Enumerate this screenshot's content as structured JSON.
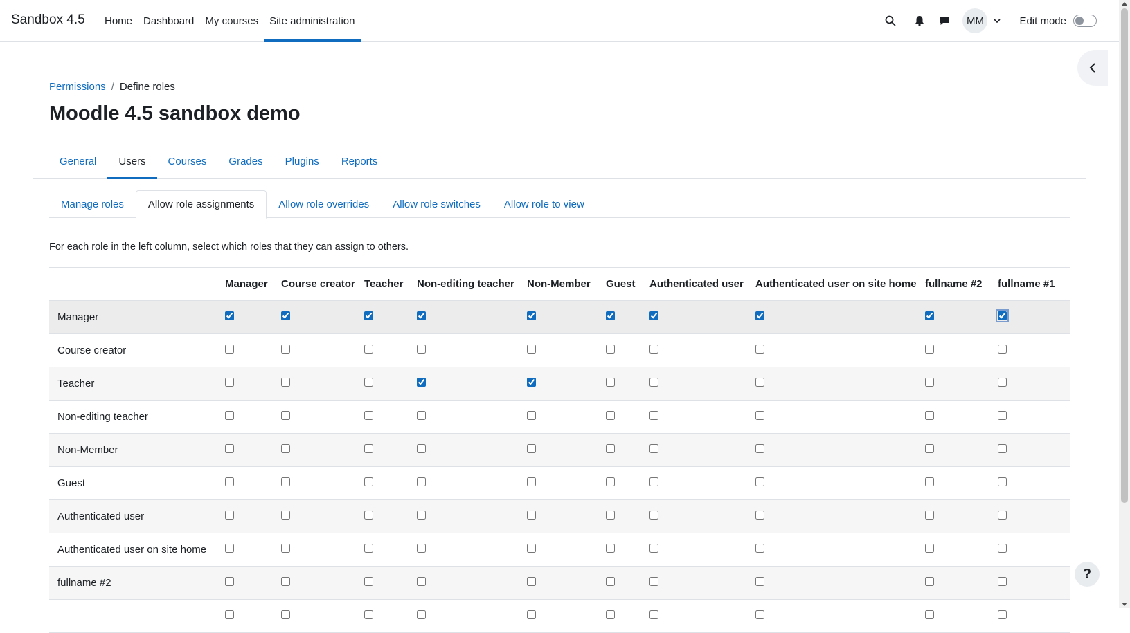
{
  "navbar": {
    "brand": "Sandbox 4.5",
    "items": [
      {
        "label": "Home"
      },
      {
        "label": "Dashboard"
      },
      {
        "label": "My courses"
      },
      {
        "label": "Site administration"
      }
    ],
    "user_initials": "MM",
    "edit_mode_label": "Edit mode"
  },
  "breadcrumb": {
    "link": "Permissions",
    "separator": "/",
    "current": "Define roles"
  },
  "page_title": "Moodle 4.5 sandbox demo",
  "secondary_nav": [
    {
      "label": "General"
    },
    {
      "label": "Users"
    },
    {
      "label": "Courses"
    },
    {
      "label": "Grades"
    },
    {
      "label": "Plugins"
    },
    {
      "label": "Reports"
    }
  ],
  "tabs": [
    {
      "label": "Manage roles"
    },
    {
      "label": "Allow role assignments"
    },
    {
      "label": "Allow role overrides"
    },
    {
      "label": "Allow role switches"
    },
    {
      "label": "Allow role to view"
    }
  ],
  "intro": "For each role in the left column, select which roles that they can assign to others.",
  "table": {
    "columns": [
      "Manager",
      "Course creator",
      "Teacher",
      "Non-editing teacher",
      "Non-Member",
      "Guest",
      "Authenticated user",
      "Authenticated user on site home",
      "fullname #2",
      "fullname #1"
    ],
    "rows": [
      {
        "label": "Manager",
        "checked": [
          true,
          true,
          true,
          true,
          true,
          true,
          true,
          true,
          true,
          true
        ]
      },
      {
        "label": "Course creator",
        "checked": [
          false,
          false,
          false,
          false,
          false,
          false,
          false,
          false,
          false,
          false
        ]
      },
      {
        "label": "Teacher",
        "checked": [
          false,
          false,
          false,
          true,
          true,
          false,
          false,
          false,
          false,
          false
        ]
      },
      {
        "label": "Non-editing teacher",
        "checked": [
          false,
          false,
          false,
          false,
          false,
          false,
          false,
          false,
          false,
          false
        ]
      },
      {
        "label": "Non-Member",
        "checked": [
          false,
          false,
          false,
          false,
          false,
          false,
          false,
          false,
          false,
          false
        ]
      },
      {
        "label": "Guest",
        "checked": [
          false,
          false,
          false,
          false,
          false,
          false,
          false,
          false,
          false,
          false
        ]
      },
      {
        "label": "Authenticated user",
        "checked": [
          false,
          false,
          false,
          false,
          false,
          false,
          false,
          false,
          false,
          false
        ]
      },
      {
        "label": "Authenticated user on site home",
        "checked": [
          false,
          false,
          false,
          false,
          false,
          false,
          false,
          false,
          false,
          false
        ]
      },
      {
        "label": "fullname #2",
        "checked": [
          false,
          false,
          false,
          false,
          false,
          false,
          false,
          false,
          false,
          false
        ]
      },
      {
        "label": "",
        "checked": [
          false,
          false,
          false,
          false,
          false,
          false,
          false,
          false,
          false,
          false
        ]
      }
    ]
  },
  "help_label": "?",
  "colors": {
    "accent": "#0f6cbf",
    "text": "#1d2125",
    "border": "#dee2e6"
  }
}
